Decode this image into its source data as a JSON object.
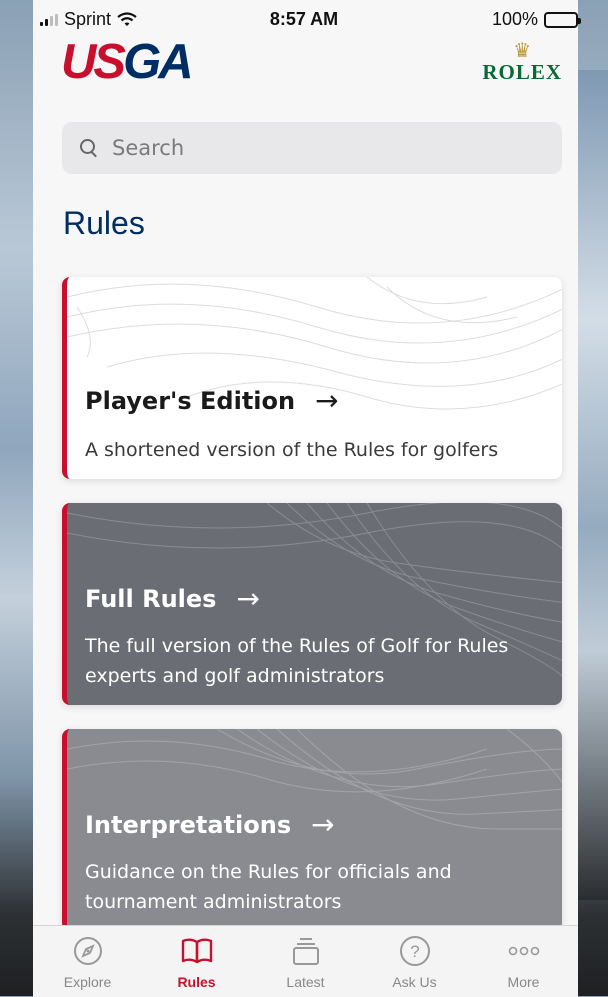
{
  "status_bar": {
    "carrier": "Sprint",
    "time": "8:57 AM",
    "battery": "100%",
    "battery_level": 1.0
  },
  "header": {
    "brand_us": "US",
    "brand_ga": "GA",
    "sponsor": "ROLEX",
    "sponsor_icon": "crown-icon"
  },
  "search": {
    "placeholder": "Search",
    "value": ""
  },
  "page_title": "Rules",
  "cards": [
    {
      "title": "Player's Edition",
      "description": "A shortened version of the Rules for golfers"
    },
    {
      "title": "Full Rules",
      "description": "The full version of the Rules of Golf for Rules experts and golf administrators"
    },
    {
      "title": "Interpretations",
      "description": "Guidance on the Rules for officials and tournament administrators"
    }
  ],
  "tabs": [
    {
      "label": "Explore",
      "icon": "compass-icon",
      "active": false
    },
    {
      "label": "Rules",
      "icon": "book-icon",
      "active": true
    },
    {
      "label": "Latest",
      "icon": "stack-icon",
      "active": false
    },
    {
      "label": "Ask Us",
      "icon": "question-icon",
      "active": false
    },
    {
      "label": "More",
      "icon": "more-dots-icon",
      "active": false
    }
  ],
  "colors": {
    "brand_red": "#c8102e",
    "brand_navy": "#002d62",
    "rolex_green": "#0a6a36",
    "rolex_gold": "#b89a3c"
  }
}
